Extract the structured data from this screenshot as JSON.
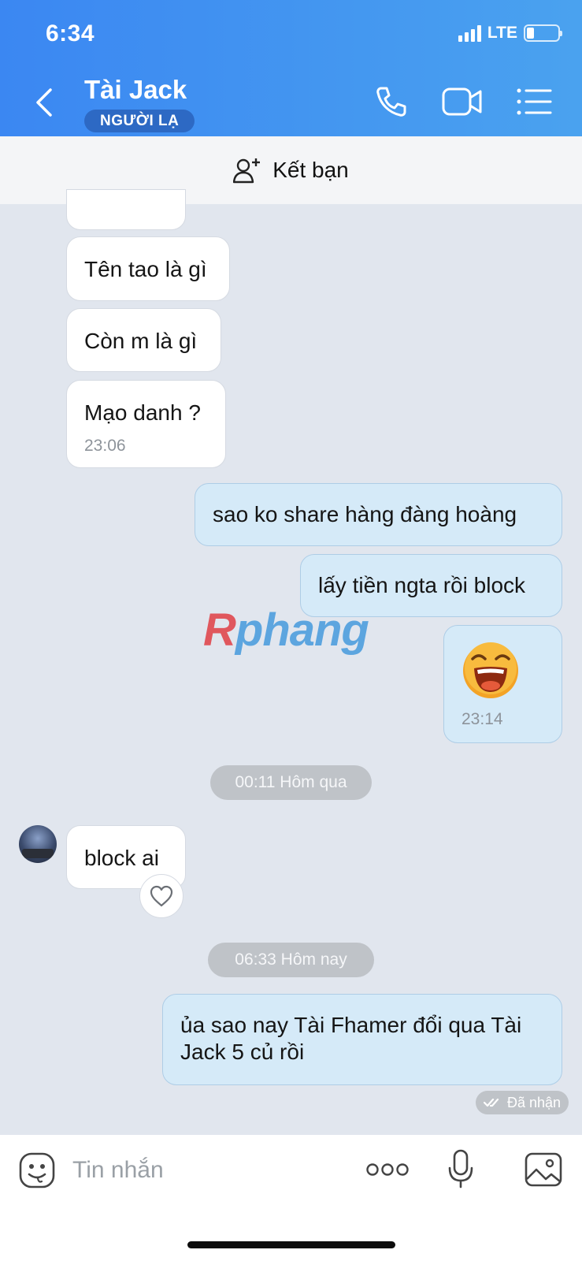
{
  "status_bar": {
    "time": "6:34",
    "network": "LTE"
  },
  "header": {
    "title": "Tài Jack",
    "badge": "NGƯỜI LẠ",
    "icons": [
      "back-chevron-icon",
      "phone-icon",
      "video-camera-icon",
      "list-menu-icon"
    ]
  },
  "add_friend_bar": {
    "label": "Kết bạn",
    "icon": "add-person-icon"
  },
  "messages": {
    "m1": {
      "text": "Tên tao là gì"
    },
    "m2": {
      "text": "Còn m là gì"
    },
    "m3": {
      "text": "Mạo danh ?",
      "time": "23:06"
    },
    "m4": {
      "text": "sao ko share hàng đàng hoàng"
    },
    "m5": {
      "text": "lấy tiền ngta rồi block"
    },
    "m6": {
      "sticker": "laughing-face-sticker",
      "time": "23:14"
    },
    "m7": {
      "text": "block ai"
    },
    "m8": {
      "text": "ủa sao nay Tài Fhamer đổi qua Tài Jack 5 củ rồi"
    }
  },
  "separators": {
    "s1": "00:11 Hôm qua",
    "s2": "06:33 Hôm nay"
  },
  "delivery_status": "Đã nhận",
  "watermark": "Rphang",
  "composer": {
    "placeholder": "Tin nhắn",
    "icons": [
      "emoji-icon",
      "more-dots-icon",
      "microphone-icon",
      "image-icon"
    ]
  },
  "colors": {
    "header_start": "#3b87f2",
    "header_end": "#4aa2ef",
    "chat_bg": "#e1e6ee",
    "outgoing_bubble": "#d5eaf8",
    "incoming_bubble": "#ffffff"
  }
}
